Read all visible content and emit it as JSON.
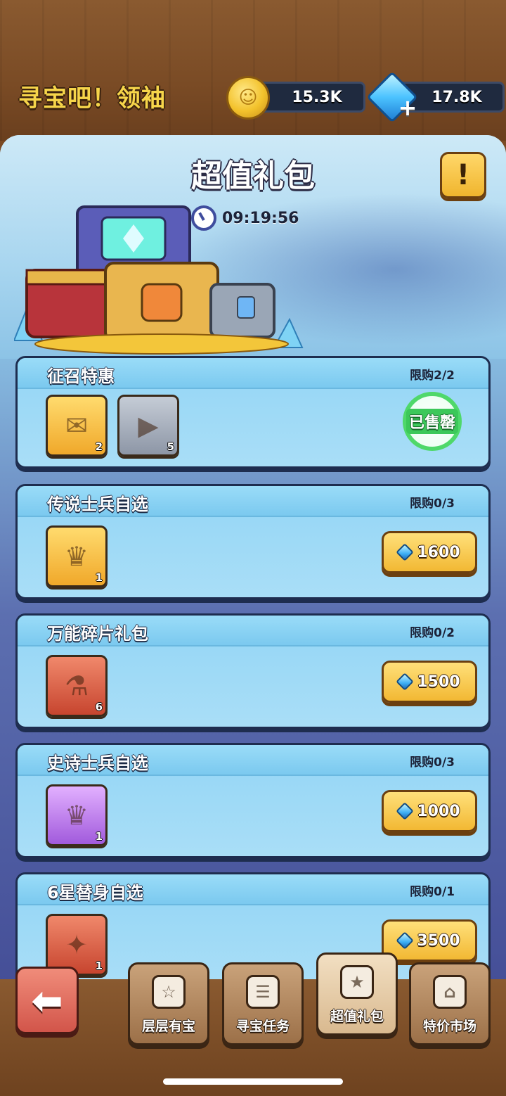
{
  "header": {
    "game_title": "寻宝吧！领袖",
    "coins": "15.3K",
    "gems": "17.8K"
  },
  "panel": {
    "title": "超值礼包",
    "info_label": "!",
    "timer": "09:19:56"
  },
  "packs": [
    {
      "title": "征召特惠",
      "limit": "限购2/2",
      "items": [
        {
          "count": "2",
          "icon": "scroll-icon"
        },
        {
          "count": "5",
          "icon": "ticket-icon"
        }
      ],
      "sold_out_label": "已售罄"
    },
    {
      "title": "传说士兵自选",
      "limit": "限购0/3",
      "items": [
        {
          "count": "1",
          "icon": "legendary-chest-icon"
        }
      ],
      "price": "1600"
    },
    {
      "title": "万能碎片礼包",
      "limit": "限购0/2",
      "items": [
        {
          "count": "6",
          "icon": "shard-potion-icon"
        }
      ],
      "price": "1500"
    },
    {
      "title": "史诗士兵自选",
      "limit": "限购0/3",
      "items": [
        {
          "count": "1",
          "icon": "epic-chest-icon"
        }
      ],
      "price": "1000"
    },
    {
      "title": "6星替身自选",
      "limit": "限购0/1",
      "items": [
        {
          "count": "1",
          "icon": "substitute-chest-icon"
        }
      ],
      "price": "3500"
    }
  ],
  "nav": {
    "tabs": [
      {
        "label": "层层有宝",
        "icon": "layers-treasure-icon"
      },
      {
        "label": "寻宝任务",
        "icon": "task-list-icon"
      },
      {
        "label": "超值礼包",
        "icon": "gift-box-icon"
      },
      {
        "label": "特价市场",
        "icon": "shop-icon"
      }
    ]
  },
  "colors": {
    "accent_gold": "#f2b833",
    "panel_blue": "#9ad8f6",
    "sold_out_green": "#3cc85a"
  }
}
